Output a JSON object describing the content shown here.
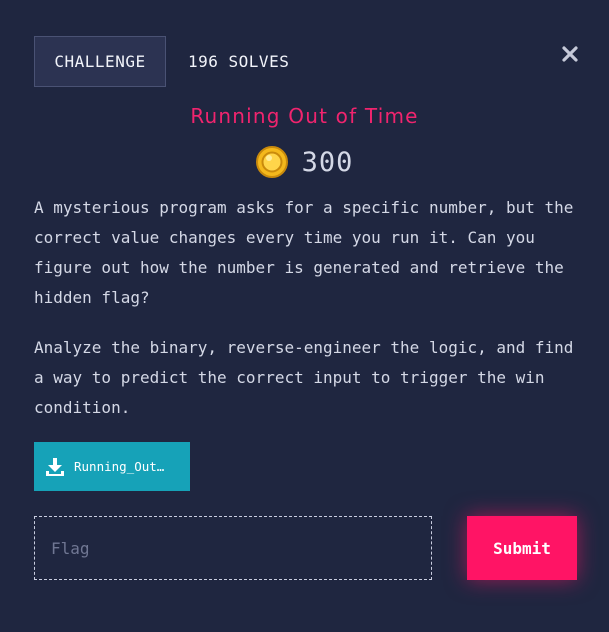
{
  "header": {
    "tab_challenge": "CHALLENGE",
    "tab_solves": "196 SOLVES"
  },
  "challenge": {
    "title": "Running Out of Time",
    "points": "300",
    "description_1": "A mysterious program asks for a specific number, but the correct value changes every time you run it. Can you figure out how the number is generated and retrieve the hidden flag?",
    "description_2": "Analyze the binary, reverse-engineer the logic, and find a way to predict the correct input to trigger the win condition.",
    "download_label": "Running_Out…"
  },
  "form": {
    "flag_value": "",
    "flag_placeholder": "Flag",
    "submit_label": "Submit"
  },
  "icons": {
    "close": "close-icon",
    "coin": "coin-icon",
    "download": "download-icon"
  },
  "colors": {
    "background": "#1f2640",
    "title": "#f0246e",
    "download_button": "#16a2b8",
    "submit_button": "#ff1465",
    "coin": "#f4b81c"
  }
}
